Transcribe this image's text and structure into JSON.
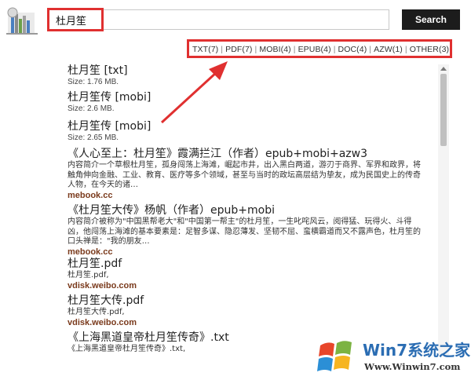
{
  "search": {
    "query": "杜月笙",
    "button_label": "Search"
  },
  "filters": [
    {
      "label": "TXT(7)"
    },
    {
      "label": "PDF(7)"
    },
    {
      "label": "MOBI(4)"
    },
    {
      "label": "EPUB(4)"
    },
    {
      "label": "DOC(4)"
    },
    {
      "label": "AZW(1)"
    },
    {
      "label": "OTHER(3)"
    }
  ],
  "separator": "|",
  "results": [
    {
      "title": "杜月笙 [txt]",
      "size": "Size: 1.76 MB."
    },
    {
      "title": "杜月笙传 [mobi]",
      "size": "Size: 2.6 MB."
    },
    {
      "title": "杜月笙传 [mobi]",
      "size": "Size: 2.65 MB."
    },
    {
      "title": "《人心至上：杜月笙》霞满拦江（作者）epub+mobi+azw3",
      "desc1": "内容简介一个草根杜月笙，孤身闯荡上海滩，崛起市井，出入黑白两道，游刃于商界、军界和政界，将",
      "desc2": "触角伸向金融、工业、教育、医疗等多个领域，甚至与当时的政坛高层结为挚友，成为民国史上的传奇",
      "desc3": "人物，在今天的诸…",
      "source": "mebook.cc"
    },
    {
      "title": "《杜月笙大传》杨帆（作者）epub+mobi",
      "desc1": "内容简介被称为\"中国黑帮老大\"和\"中国第一帮主\"的杜月笙，一生叱咤风云，阅得猛、玩得火、斗得",
      "desc2": "凶，他闯荡上海滩的基本要素是：足智多谋、隐忍薄发、坚韧不屈、蛮横霸道而又不露声色，杜月笙的",
      "desc3": "口头禅是：\"我的朋友…",
      "source": "mebook.cc"
    },
    {
      "title": "杜月笙.pdf",
      "sub": "杜月笙.pdf,",
      "source": "vdisk.weibo.com"
    },
    {
      "title": "杜月笙大传.pdf",
      "sub": "杜月笙大传.pdf,",
      "source": "vdisk.weibo.com"
    },
    {
      "title": "《上海黑道皇帝杜月笙传奇》.txt",
      "sub": "《上海黑道皇帝杜月笙传奇》.txt,"
    }
  ],
  "watermark": {
    "brand": "Win7系统之家",
    "url": "Www.Winwin7.com"
  },
  "colors": {
    "highlight": "#e03030",
    "button": "#1c1c1c",
    "source": "#7a3a1c",
    "brand": "#2b6db3"
  }
}
